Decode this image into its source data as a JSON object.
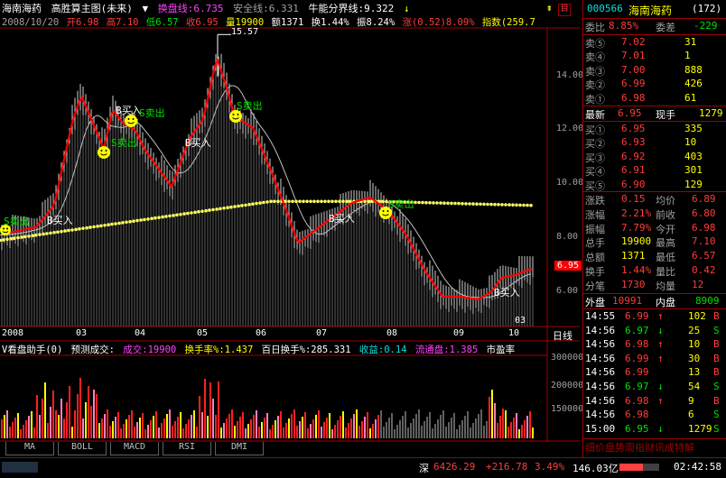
{
  "title": {
    "stock_name": "海南海药",
    "indicator": "高胜算主图(未来)",
    "dropdown": "▼",
    "huanpan": "换盘线:6.735",
    "anquan": "安全线:6.331",
    "niuneng": "牛能分界线:9.322"
  },
  "ohlc": {
    "date": "2008/10/20",
    "open": "开6.98",
    "high": "高7.10",
    "low": "低6.57",
    "close": "收6.95",
    "volume": "量19900",
    "amount": "额1371",
    "turnover": "换1.44%",
    "amplitude": "振8.24%",
    "change": "涨(0.52)8.09%",
    "index": "指数(259.7"
  },
  "price_axis": [
    "14.00",
    "12.00",
    "10.00",
    "8.00",
    "6.00"
  ],
  "price_current": "6.95",
  "peak_label": "15.57",
  "low_label": "03",
  "month_labels": [
    "2008",
    "03",
    "04",
    "05",
    "06",
    "07",
    "08",
    "09",
    "10"
  ],
  "period_label": "日线",
  "signals": [
    "S卖出",
    "B买入",
    "B买入",
    "S卖出",
    "S卖出",
    "B买入",
    "S卖出",
    "B买入",
    "S卖出",
    "B买入"
  ],
  "volume_panel": {
    "name": "V看盘助手(0)",
    "forecast": "预测成交:",
    "vol": "成交:19900",
    "turnover_rate": "换手率%:1.437",
    "hundred_day": "百日换手%:285.331",
    "shou_yi": "收益:0.14",
    "float": "流通盘:1.385",
    "pe": "市盈率",
    "axis": [
      "300000",
      "200000",
      "150000"
    ]
  },
  "tabs": [
    "MA",
    "BOLL",
    "MACD",
    "RSI",
    "DMI"
  ],
  "panel": {
    "code": "000566",
    "name": "海南海药",
    "count": "(172)",
    "weibi_label": "委比",
    "weibi": "8.85%",
    "weicha_label": "委差",
    "weicha": "-229",
    "sell": [
      {
        "label": "卖⑤",
        "price": "7.02",
        "vol": "31"
      },
      {
        "label": "卖④",
        "price": "7.01",
        "vol": "1"
      },
      {
        "label": "卖③",
        "price": "7.00",
        "vol": "888"
      },
      {
        "label": "卖②",
        "price": "6.99",
        "vol": "426"
      },
      {
        "label": "卖①",
        "price": "6.98",
        "vol": "61"
      }
    ],
    "latest_label": "最新",
    "latest": "6.95",
    "xianshou_label": "现手",
    "xianshou": "1279",
    "buy": [
      {
        "label": "买①",
        "price": "6.95",
        "vol": "335"
      },
      {
        "label": "买②",
        "price": "6.93",
        "vol": "10"
      },
      {
        "label": "买③",
        "price": "6.92",
        "vol": "403"
      },
      {
        "label": "买④",
        "price": "6.91",
        "vol": "301"
      },
      {
        "label": "买⑤",
        "price": "6.90",
        "vol": "129"
      }
    ],
    "stats": [
      {
        "l1": "涨跌",
        "v1": "0.15",
        "l2": "均价",
        "v2": "6.89"
      },
      {
        "l1": "涨幅",
        "v1": "2.21%",
        "l2": "前收",
        "v2": "6.80"
      },
      {
        "l1": "振幅",
        "v1": "7.79%",
        "l2": "今开",
        "v2": "6.98"
      },
      {
        "l1": "总手",
        "v1": "19900",
        "l2": "最高",
        "v2": "7.10"
      },
      {
        "l1": "总额",
        "v1": "1371",
        "l2": "最低",
        "v2": "6.57"
      },
      {
        "l1": "换手",
        "v1": "1.44%",
        "l2": "量比",
        "v2": "0.42"
      },
      {
        "l1": "分笔",
        "v1": "1730",
        "l2": "均量",
        "v2": "12"
      }
    ],
    "waipan_label": "外盘",
    "waipan": "10991",
    "neipan_label": "内盘",
    "neipan": "8909",
    "ticks": [
      {
        "time": "14:55",
        "price": "6.99",
        "dir": "↑",
        "vol": "102",
        "side": "B"
      },
      {
        "time": "14:56",
        "price": "6.97",
        "dir": "↓",
        "vol": "25",
        "side": "S"
      },
      {
        "time": "14:56",
        "price": "6.98",
        "dir": "↑",
        "vol": "10",
        "side": "B"
      },
      {
        "time": "14:56",
        "price": "6.99",
        "dir": "↑",
        "vol": "30",
        "side": "B"
      },
      {
        "time": "14:56",
        "price": "6.99",
        "dir": "",
        "vol": "13",
        "side": "B"
      },
      {
        "time": "14:56",
        "price": "6.97",
        "dir": "↓",
        "vol": "54",
        "side": "S"
      },
      {
        "time": "14:56",
        "price": "6.98",
        "dir": "↑",
        "vol": "9",
        "side": "B"
      },
      {
        "time": "14:56",
        "price": "6.98",
        "dir": "",
        "vol": "6",
        "side": "S"
      },
      {
        "time": "15:00",
        "price": "6.95",
        "dir": "↓",
        "vol": "1279",
        "side": "S"
      }
    ],
    "footer_tabs": "细价盘势周指财讯成特解"
  },
  "status": {
    "market": "深",
    "index": "6426.29",
    "change": "+216.78",
    "pct": "3.49%",
    "amount": "146.03亿",
    "time": "02:42:58"
  },
  "colors": {
    "up": "#ff3c3c",
    "down": "#00e000",
    "accent": "#ffff00",
    "line": "#ff0000"
  }
}
